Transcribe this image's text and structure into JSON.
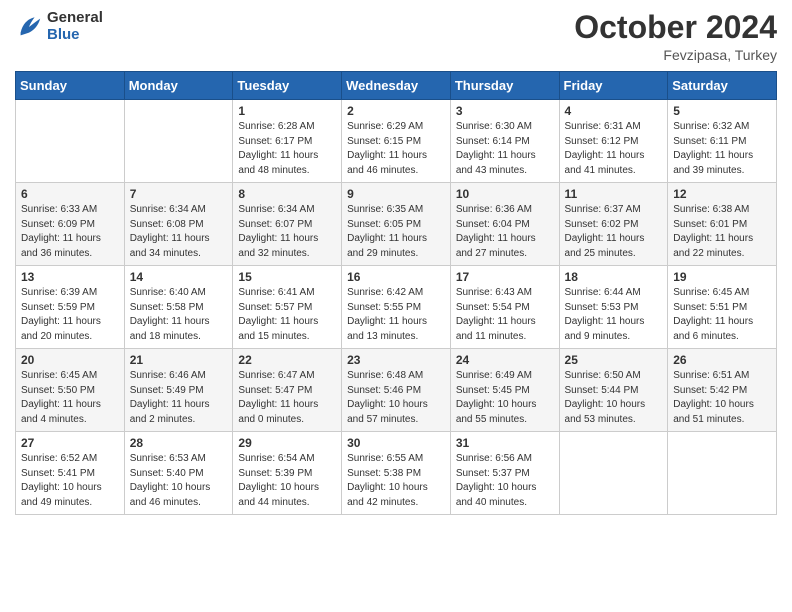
{
  "header": {
    "logo_general": "General",
    "logo_blue": "Blue",
    "month_year": "October 2024",
    "location": "Fevzipasa, Turkey"
  },
  "weekdays": [
    "Sunday",
    "Monday",
    "Tuesday",
    "Wednesday",
    "Thursday",
    "Friday",
    "Saturday"
  ],
  "weeks": [
    [
      {
        "day": "",
        "sunrise": "",
        "sunset": "",
        "daylight": ""
      },
      {
        "day": "",
        "sunrise": "",
        "sunset": "",
        "daylight": ""
      },
      {
        "day": "1",
        "sunrise": "Sunrise: 6:28 AM",
        "sunset": "Sunset: 6:17 PM",
        "daylight": "Daylight: 11 hours and 48 minutes."
      },
      {
        "day": "2",
        "sunrise": "Sunrise: 6:29 AM",
        "sunset": "Sunset: 6:15 PM",
        "daylight": "Daylight: 11 hours and 46 minutes."
      },
      {
        "day": "3",
        "sunrise": "Sunrise: 6:30 AM",
        "sunset": "Sunset: 6:14 PM",
        "daylight": "Daylight: 11 hours and 43 minutes."
      },
      {
        "day": "4",
        "sunrise": "Sunrise: 6:31 AM",
        "sunset": "Sunset: 6:12 PM",
        "daylight": "Daylight: 11 hours and 41 minutes."
      },
      {
        "day": "5",
        "sunrise": "Sunrise: 6:32 AM",
        "sunset": "Sunset: 6:11 PM",
        "daylight": "Daylight: 11 hours and 39 minutes."
      }
    ],
    [
      {
        "day": "6",
        "sunrise": "Sunrise: 6:33 AM",
        "sunset": "Sunset: 6:09 PM",
        "daylight": "Daylight: 11 hours and 36 minutes."
      },
      {
        "day": "7",
        "sunrise": "Sunrise: 6:34 AM",
        "sunset": "Sunset: 6:08 PM",
        "daylight": "Daylight: 11 hours and 34 minutes."
      },
      {
        "day": "8",
        "sunrise": "Sunrise: 6:34 AM",
        "sunset": "Sunset: 6:07 PM",
        "daylight": "Daylight: 11 hours and 32 minutes."
      },
      {
        "day": "9",
        "sunrise": "Sunrise: 6:35 AM",
        "sunset": "Sunset: 6:05 PM",
        "daylight": "Daylight: 11 hours and 29 minutes."
      },
      {
        "day": "10",
        "sunrise": "Sunrise: 6:36 AM",
        "sunset": "Sunset: 6:04 PM",
        "daylight": "Daylight: 11 hours and 27 minutes."
      },
      {
        "day": "11",
        "sunrise": "Sunrise: 6:37 AM",
        "sunset": "Sunset: 6:02 PM",
        "daylight": "Daylight: 11 hours and 25 minutes."
      },
      {
        "day": "12",
        "sunrise": "Sunrise: 6:38 AM",
        "sunset": "Sunset: 6:01 PM",
        "daylight": "Daylight: 11 hours and 22 minutes."
      }
    ],
    [
      {
        "day": "13",
        "sunrise": "Sunrise: 6:39 AM",
        "sunset": "Sunset: 5:59 PM",
        "daylight": "Daylight: 11 hours and 20 minutes."
      },
      {
        "day": "14",
        "sunrise": "Sunrise: 6:40 AM",
        "sunset": "Sunset: 5:58 PM",
        "daylight": "Daylight: 11 hours and 18 minutes."
      },
      {
        "day": "15",
        "sunrise": "Sunrise: 6:41 AM",
        "sunset": "Sunset: 5:57 PM",
        "daylight": "Daylight: 11 hours and 15 minutes."
      },
      {
        "day": "16",
        "sunrise": "Sunrise: 6:42 AM",
        "sunset": "Sunset: 5:55 PM",
        "daylight": "Daylight: 11 hours and 13 minutes."
      },
      {
        "day": "17",
        "sunrise": "Sunrise: 6:43 AM",
        "sunset": "Sunset: 5:54 PM",
        "daylight": "Daylight: 11 hours and 11 minutes."
      },
      {
        "day": "18",
        "sunrise": "Sunrise: 6:44 AM",
        "sunset": "Sunset: 5:53 PM",
        "daylight": "Daylight: 11 hours and 9 minutes."
      },
      {
        "day": "19",
        "sunrise": "Sunrise: 6:45 AM",
        "sunset": "Sunset: 5:51 PM",
        "daylight": "Daylight: 11 hours and 6 minutes."
      }
    ],
    [
      {
        "day": "20",
        "sunrise": "Sunrise: 6:45 AM",
        "sunset": "Sunset: 5:50 PM",
        "daylight": "Daylight: 11 hours and 4 minutes."
      },
      {
        "day": "21",
        "sunrise": "Sunrise: 6:46 AM",
        "sunset": "Sunset: 5:49 PM",
        "daylight": "Daylight: 11 hours and 2 minutes."
      },
      {
        "day": "22",
        "sunrise": "Sunrise: 6:47 AM",
        "sunset": "Sunset: 5:47 PM",
        "daylight": "Daylight: 11 hours and 0 minutes."
      },
      {
        "day": "23",
        "sunrise": "Sunrise: 6:48 AM",
        "sunset": "Sunset: 5:46 PM",
        "daylight": "Daylight: 10 hours and 57 minutes."
      },
      {
        "day": "24",
        "sunrise": "Sunrise: 6:49 AM",
        "sunset": "Sunset: 5:45 PM",
        "daylight": "Daylight: 10 hours and 55 minutes."
      },
      {
        "day": "25",
        "sunrise": "Sunrise: 6:50 AM",
        "sunset": "Sunset: 5:44 PM",
        "daylight": "Daylight: 10 hours and 53 minutes."
      },
      {
        "day": "26",
        "sunrise": "Sunrise: 6:51 AM",
        "sunset": "Sunset: 5:42 PM",
        "daylight": "Daylight: 10 hours and 51 minutes."
      }
    ],
    [
      {
        "day": "27",
        "sunrise": "Sunrise: 6:52 AM",
        "sunset": "Sunset: 5:41 PM",
        "daylight": "Daylight: 10 hours and 49 minutes."
      },
      {
        "day": "28",
        "sunrise": "Sunrise: 6:53 AM",
        "sunset": "Sunset: 5:40 PM",
        "daylight": "Daylight: 10 hours and 46 minutes."
      },
      {
        "day": "29",
        "sunrise": "Sunrise: 6:54 AM",
        "sunset": "Sunset: 5:39 PM",
        "daylight": "Daylight: 10 hours and 44 minutes."
      },
      {
        "day": "30",
        "sunrise": "Sunrise: 6:55 AM",
        "sunset": "Sunset: 5:38 PM",
        "daylight": "Daylight: 10 hours and 42 minutes."
      },
      {
        "day": "31",
        "sunrise": "Sunrise: 6:56 AM",
        "sunset": "Sunset: 5:37 PM",
        "daylight": "Daylight: 10 hours and 40 minutes."
      },
      {
        "day": "",
        "sunrise": "",
        "sunset": "",
        "daylight": ""
      },
      {
        "day": "",
        "sunrise": "",
        "sunset": "",
        "daylight": ""
      }
    ]
  ]
}
